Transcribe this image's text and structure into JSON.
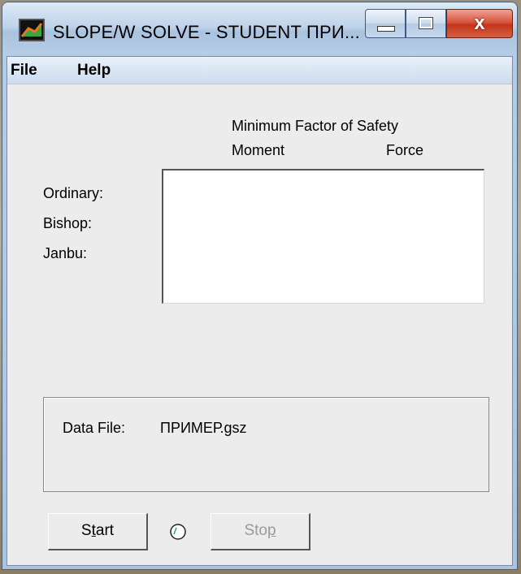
{
  "window": {
    "title": "SLOPE/W SOLVE - STUDENT ПРИ...",
    "close_glyph": "x",
    "icons": {
      "app": "slopew-app-icon",
      "minimize": "minimize-icon",
      "maximize": "maximize-icon",
      "close": "close-icon"
    }
  },
  "menu": {
    "file": "File",
    "help": "Help"
  },
  "results": {
    "header": "Minimum Factor of Safety",
    "col_moment": "Moment",
    "col_force": "Force",
    "rows": [
      "Ordinary:",
      "Bishop:",
      "Janbu:"
    ]
  },
  "data_file": {
    "label": "Data File:",
    "value": "ПРИМЕР.gsz"
  },
  "buttons": {
    "start_pre": "S",
    "start_mnemonic": "t",
    "start_post": "art",
    "stop_pre": "Sto",
    "stop_mnemonic": "p",
    "stop_enabled": false
  },
  "status": {
    "spinner_icon": "progress-spinner-icon"
  }
}
